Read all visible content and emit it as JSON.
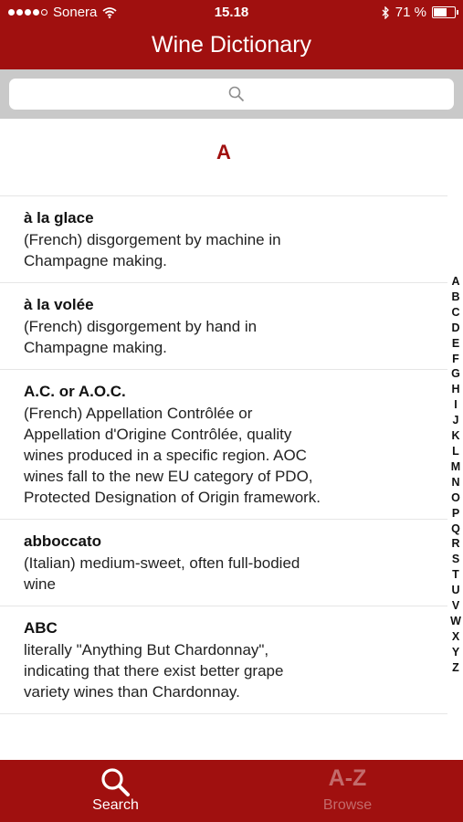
{
  "status": {
    "carrier": "Sonera",
    "time": "15.18",
    "battery": "71 %",
    "battery_level": 0.71
  },
  "nav": {
    "title": "Wine Dictionary"
  },
  "search": {
    "placeholder": ""
  },
  "section": {
    "letter": "A"
  },
  "entries": [
    {
      "term": "à la glace",
      "def": "(French) disgorgement by machine in Champagne making."
    },
    {
      "term": "à la volée",
      "def": "(French) disgorgement by hand in Champagne making."
    },
    {
      "term": "A.C. or A.O.C.",
      "def": "(French) Appellation Contrôlée or Appellation d'Origine Contrôlée, quality wines produced in a specific region. AOC wines fall to the new EU category of PDO, Protected Designation of Origin framework."
    },
    {
      "term": "abboccato",
      "def": "(Italian) medium-sweet, often full-bodied wine"
    },
    {
      "term": "ABC",
      "def": "literally \"Anything But Chardonnay\", indicating that there exist better grape variety wines than Chardonnay."
    }
  ],
  "index_letters": [
    "A",
    "B",
    "C",
    "D",
    "E",
    "F",
    "G",
    "H",
    "I",
    "J",
    "K",
    "L",
    "M",
    "N",
    "O",
    "P",
    "Q",
    "R",
    "S",
    "T",
    "U",
    "V",
    "W",
    "X",
    "Y",
    "Z"
  ],
  "tabs": {
    "search": {
      "label": "Search",
      "icon": "search-icon"
    },
    "browse": {
      "label": "Browse",
      "icon_text": "A-Z"
    }
  },
  "colors": {
    "brand": "#a0100f",
    "inactive_tab": "#c36b6b"
  }
}
